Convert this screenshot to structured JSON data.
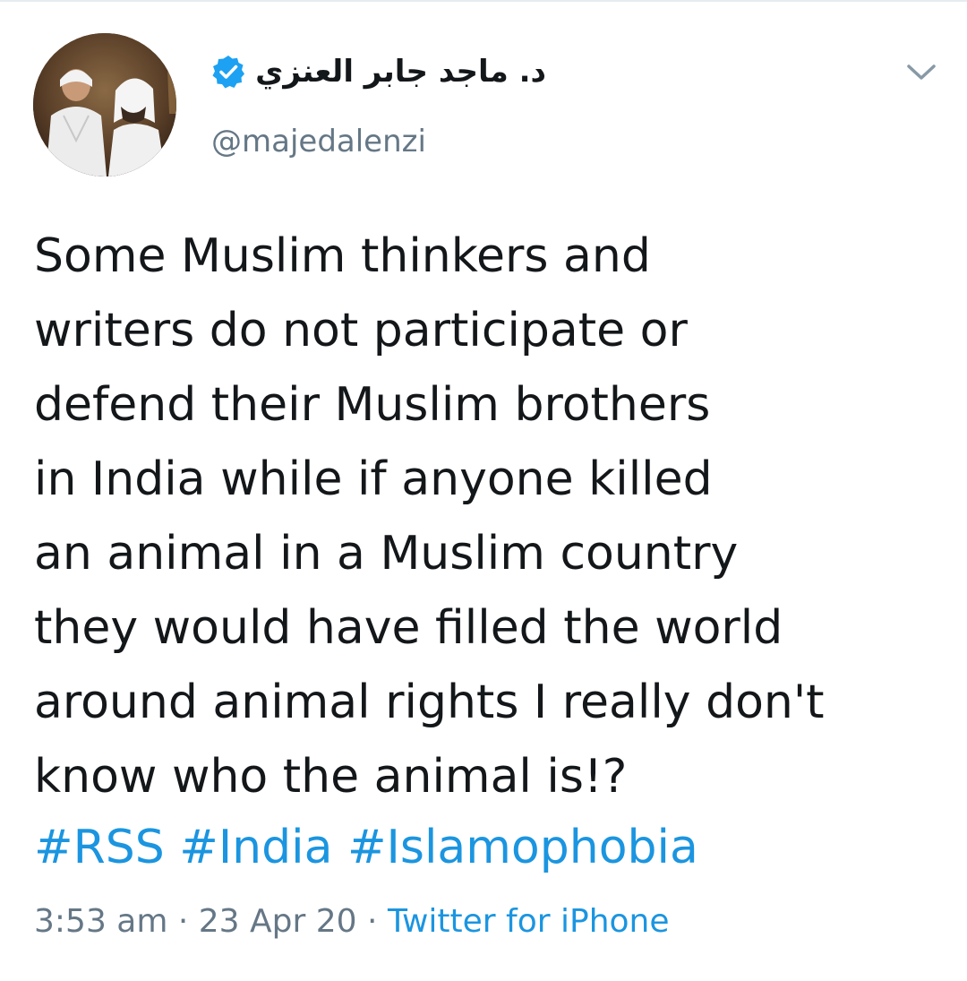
{
  "user": {
    "display_name": "د. ماجد جابر العنزي",
    "handle": "@majedalenzi",
    "verified": true
  },
  "tweet": {
    "lines": [
      "Some Muslim thinkers and",
      "writers do not participate or",
      "defend their Muslim brothers",
      "in India while if anyone killed",
      "an animal in a Muslim country",
      "they would have filled the world",
      "around animal rights I really don't",
      "know who the animal is!?"
    ],
    "hashtags": [
      "#RSS",
      "#India",
      "#Islamophobia"
    ]
  },
  "meta": {
    "time": "3:53 am",
    "separator": "·",
    "date": "23 Apr 20",
    "source": "Twitter for iPhone"
  },
  "icons": {
    "verified": "verified-badge-icon",
    "menu": "chevron-down-icon"
  },
  "colors": {
    "link": "#1b95e0",
    "secondary_text": "#657786",
    "primary_text": "#14171a",
    "verified": "#1da1f2"
  }
}
